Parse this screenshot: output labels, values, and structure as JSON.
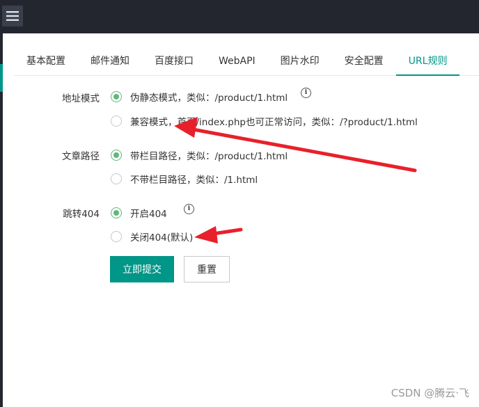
{
  "header": {
    "menu_icon": "hamburger-menu-icon"
  },
  "tabs": [
    {
      "label": "基本配置",
      "active": false
    },
    {
      "label": "邮件通知",
      "active": false
    },
    {
      "label": "百度接口",
      "active": false
    },
    {
      "label": "WebAPI",
      "active": false
    },
    {
      "label": "图片水印",
      "active": false
    },
    {
      "label": "安全配置",
      "active": false
    },
    {
      "label": "URL规则",
      "active": true
    }
  ],
  "form": {
    "url_mode": {
      "label": "地址模式",
      "options": [
        {
          "text": "伪静态模式，类似：/product/1.html",
          "checked": true
        },
        {
          "text": "兼容模式，首页/index.php也可正常访问，类似：/?product/1.html",
          "checked": false
        }
      ]
    },
    "article_path": {
      "label": "文章路径",
      "options": [
        {
          "text": "带栏目路径，类似：/product/1.html",
          "checked": true
        },
        {
          "text": "不带栏目路径，类似：/1.html",
          "checked": false
        }
      ]
    },
    "redirect_404": {
      "label": "跳转404",
      "options": [
        {
          "text": "开启404",
          "checked": true
        },
        {
          "text": "关闭404(默认)",
          "checked": false
        }
      ]
    },
    "submit_label": "立即提交",
    "reset_label": "重置"
  },
  "colors": {
    "accent": "#009688",
    "radio_checked": "#5fb878",
    "annotation_arrow": "#e8202a",
    "topbar": "#23262e"
  },
  "watermark": "CSDN @腾云·飞"
}
